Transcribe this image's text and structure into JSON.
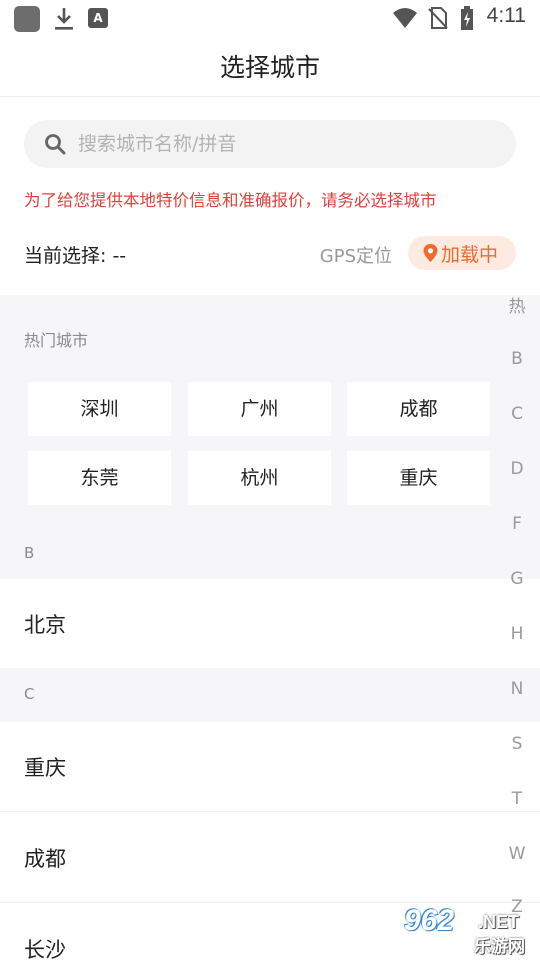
{
  "status_bar": {
    "time": "4:11"
  },
  "header": {
    "title": "选择城市"
  },
  "search": {
    "placeholder": "搜索城市名称/拼音",
    "value": ""
  },
  "notice": "为了给您提供本地特价信息和准确报价，请务必选择城市",
  "current": {
    "label": "当前选择: --",
    "gps_label": "GPS定位",
    "locate_button": "加载中"
  },
  "hot": {
    "title": "热门城市",
    "cities": [
      "深圳",
      "广州",
      "成都",
      "东莞",
      "杭州",
      "重庆"
    ]
  },
  "sections": [
    {
      "letter": "B",
      "cities": [
        "北京"
      ]
    },
    {
      "letter": "C",
      "cities": [
        "重庆",
        "成都",
        "长沙"
      ]
    }
  ],
  "index_letters": [
    "热",
    "B",
    "C",
    "D",
    "F",
    "G",
    "H",
    "N",
    "S",
    "T",
    "W",
    "Z"
  ],
  "watermark": {
    "num": "962",
    "net": ".NET",
    "cn": "乐游网"
  },
  "colors": {
    "notice": "#e2403b",
    "accent": "#ef6a2c",
    "accent_bg": "#fdebe1",
    "section_bg": "#f6f6f8"
  }
}
